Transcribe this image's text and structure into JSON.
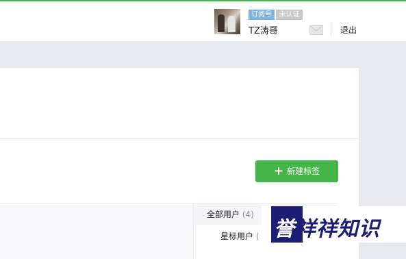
{
  "header": {
    "account_type_badge": "订阅号",
    "verification_badge": "未认证",
    "username": "TZ涛哥",
    "logout_label": "退出"
  },
  "toolbar": {
    "new_tag_button_icon": "+",
    "new_tag_button_label": "新建标签"
  },
  "tags": {
    "items": [
      {
        "label": "全部用户",
        "count": "(4)"
      },
      {
        "label": "星标用户",
        "count": "("
      }
    ]
  },
  "watermark": {
    "text_part1": "誉",
    "text_part2": "祥祥知识"
  },
  "colors": {
    "brand_green": "#44b549",
    "badge_blue": "#7fb3dd",
    "badge_gray": "#c8c8c8",
    "background": "#e8e9ee",
    "watermark_navy": "#1d1d73"
  }
}
